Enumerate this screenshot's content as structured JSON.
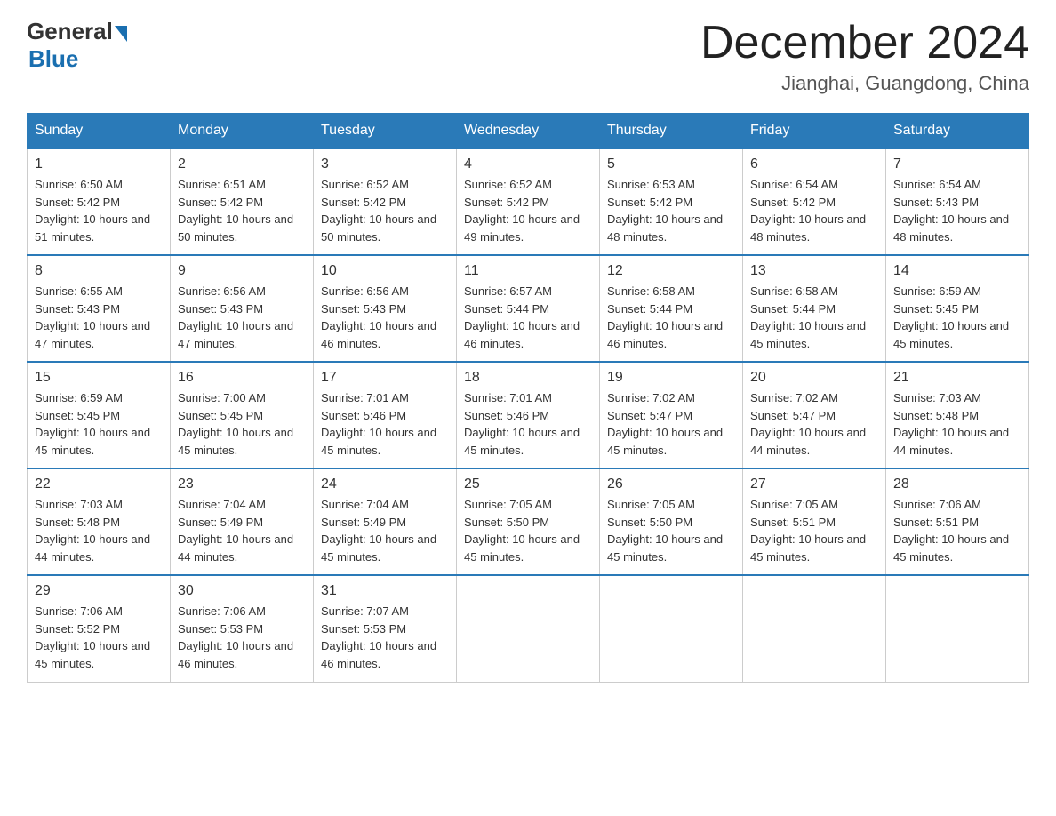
{
  "header": {
    "logo_general": "General",
    "logo_blue": "Blue",
    "month_title": "December 2024",
    "location": "Jianghai, Guangdong, China"
  },
  "days_of_week": [
    "Sunday",
    "Monday",
    "Tuesday",
    "Wednesday",
    "Thursday",
    "Friday",
    "Saturday"
  ],
  "weeks": [
    [
      {
        "day": "1",
        "sunrise": "6:50 AM",
        "sunset": "5:42 PM",
        "daylight": "10 hours and 51 minutes."
      },
      {
        "day": "2",
        "sunrise": "6:51 AM",
        "sunset": "5:42 PM",
        "daylight": "10 hours and 50 minutes."
      },
      {
        "day": "3",
        "sunrise": "6:52 AM",
        "sunset": "5:42 PM",
        "daylight": "10 hours and 50 minutes."
      },
      {
        "day": "4",
        "sunrise": "6:52 AM",
        "sunset": "5:42 PM",
        "daylight": "10 hours and 49 minutes."
      },
      {
        "day": "5",
        "sunrise": "6:53 AM",
        "sunset": "5:42 PM",
        "daylight": "10 hours and 48 minutes."
      },
      {
        "day": "6",
        "sunrise": "6:54 AM",
        "sunset": "5:42 PM",
        "daylight": "10 hours and 48 minutes."
      },
      {
        "day": "7",
        "sunrise": "6:54 AM",
        "sunset": "5:43 PM",
        "daylight": "10 hours and 48 minutes."
      }
    ],
    [
      {
        "day": "8",
        "sunrise": "6:55 AM",
        "sunset": "5:43 PM",
        "daylight": "10 hours and 47 minutes."
      },
      {
        "day": "9",
        "sunrise": "6:56 AM",
        "sunset": "5:43 PM",
        "daylight": "10 hours and 47 minutes."
      },
      {
        "day": "10",
        "sunrise": "6:56 AM",
        "sunset": "5:43 PM",
        "daylight": "10 hours and 46 minutes."
      },
      {
        "day": "11",
        "sunrise": "6:57 AM",
        "sunset": "5:44 PM",
        "daylight": "10 hours and 46 minutes."
      },
      {
        "day": "12",
        "sunrise": "6:58 AM",
        "sunset": "5:44 PM",
        "daylight": "10 hours and 46 minutes."
      },
      {
        "day": "13",
        "sunrise": "6:58 AM",
        "sunset": "5:44 PM",
        "daylight": "10 hours and 45 minutes."
      },
      {
        "day": "14",
        "sunrise": "6:59 AM",
        "sunset": "5:45 PM",
        "daylight": "10 hours and 45 minutes."
      }
    ],
    [
      {
        "day": "15",
        "sunrise": "6:59 AM",
        "sunset": "5:45 PM",
        "daylight": "10 hours and 45 minutes."
      },
      {
        "day": "16",
        "sunrise": "7:00 AM",
        "sunset": "5:45 PM",
        "daylight": "10 hours and 45 minutes."
      },
      {
        "day": "17",
        "sunrise": "7:01 AM",
        "sunset": "5:46 PM",
        "daylight": "10 hours and 45 minutes."
      },
      {
        "day": "18",
        "sunrise": "7:01 AM",
        "sunset": "5:46 PM",
        "daylight": "10 hours and 45 minutes."
      },
      {
        "day": "19",
        "sunrise": "7:02 AM",
        "sunset": "5:47 PM",
        "daylight": "10 hours and 45 minutes."
      },
      {
        "day": "20",
        "sunrise": "7:02 AM",
        "sunset": "5:47 PM",
        "daylight": "10 hours and 44 minutes."
      },
      {
        "day": "21",
        "sunrise": "7:03 AM",
        "sunset": "5:48 PM",
        "daylight": "10 hours and 44 minutes."
      }
    ],
    [
      {
        "day": "22",
        "sunrise": "7:03 AM",
        "sunset": "5:48 PM",
        "daylight": "10 hours and 44 minutes."
      },
      {
        "day": "23",
        "sunrise": "7:04 AM",
        "sunset": "5:49 PM",
        "daylight": "10 hours and 44 minutes."
      },
      {
        "day": "24",
        "sunrise": "7:04 AM",
        "sunset": "5:49 PM",
        "daylight": "10 hours and 45 minutes."
      },
      {
        "day": "25",
        "sunrise": "7:05 AM",
        "sunset": "5:50 PM",
        "daylight": "10 hours and 45 minutes."
      },
      {
        "day": "26",
        "sunrise": "7:05 AM",
        "sunset": "5:50 PM",
        "daylight": "10 hours and 45 minutes."
      },
      {
        "day": "27",
        "sunrise": "7:05 AM",
        "sunset": "5:51 PM",
        "daylight": "10 hours and 45 minutes."
      },
      {
        "day": "28",
        "sunrise": "7:06 AM",
        "sunset": "5:51 PM",
        "daylight": "10 hours and 45 minutes."
      }
    ],
    [
      {
        "day": "29",
        "sunrise": "7:06 AM",
        "sunset": "5:52 PM",
        "daylight": "10 hours and 45 minutes."
      },
      {
        "day": "30",
        "sunrise": "7:06 AM",
        "sunset": "5:53 PM",
        "daylight": "10 hours and 46 minutes."
      },
      {
        "day": "31",
        "sunrise": "7:07 AM",
        "sunset": "5:53 PM",
        "daylight": "10 hours and 46 minutes."
      },
      null,
      null,
      null,
      null
    ]
  ]
}
